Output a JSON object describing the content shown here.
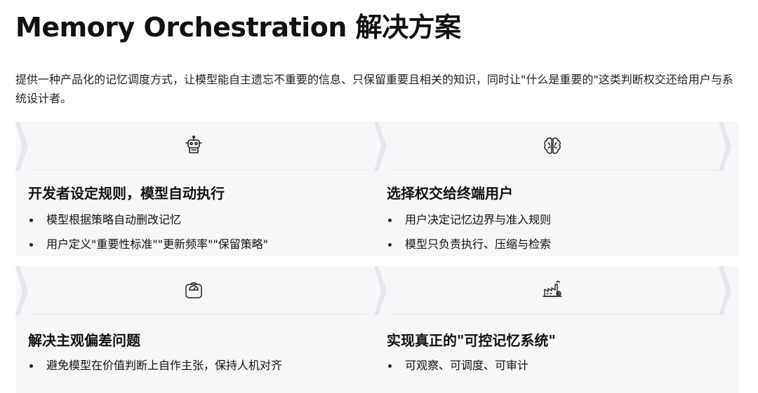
{
  "page": {
    "title": "Memory Orchestration 解决方案",
    "description": "提供一种产品化的记忆调度方式，让模型能自主遗忘不重要的信息、只保留重要且相关的知识，同时让\"什么是重要的\"这类判断权交还给用户与系统设计者。"
  },
  "cards": [
    {
      "icon": "robot-icon",
      "title": "开发者设定规则，模型自动执行",
      "bullets": [
        "模型根据策略自动删改记忆",
        "用户定义\"重要性标准\"\"更新频率\"\"保留策略\""
      ]
    },
    {
      "icon": "brain-icon",
      "title": "选择权交给终端用户",
      "bullets": [
        "用户决定记忆边界与准入规则",
        "模型只负责执行、压缩与检索"
      ]
    },
    {
      "icon": "scale-icon",
      "title": "解决主观偏差问题",
      "bullets": [
        "避免模型在价值判断上自作主张，保持人机对齐"
      ]
    },
    {
      "icon": "factory-icon",
      "title": "实现真正的\"可控记忆系统\"",
      "bullets": [
        "可观察、可调度、可审计"
      ]
    }
  ],
  "colors": {
    "card_bg": "#f7f7f9",
    "chevron": "#e6e7ec",
    "text": "#111111"
  }
}
